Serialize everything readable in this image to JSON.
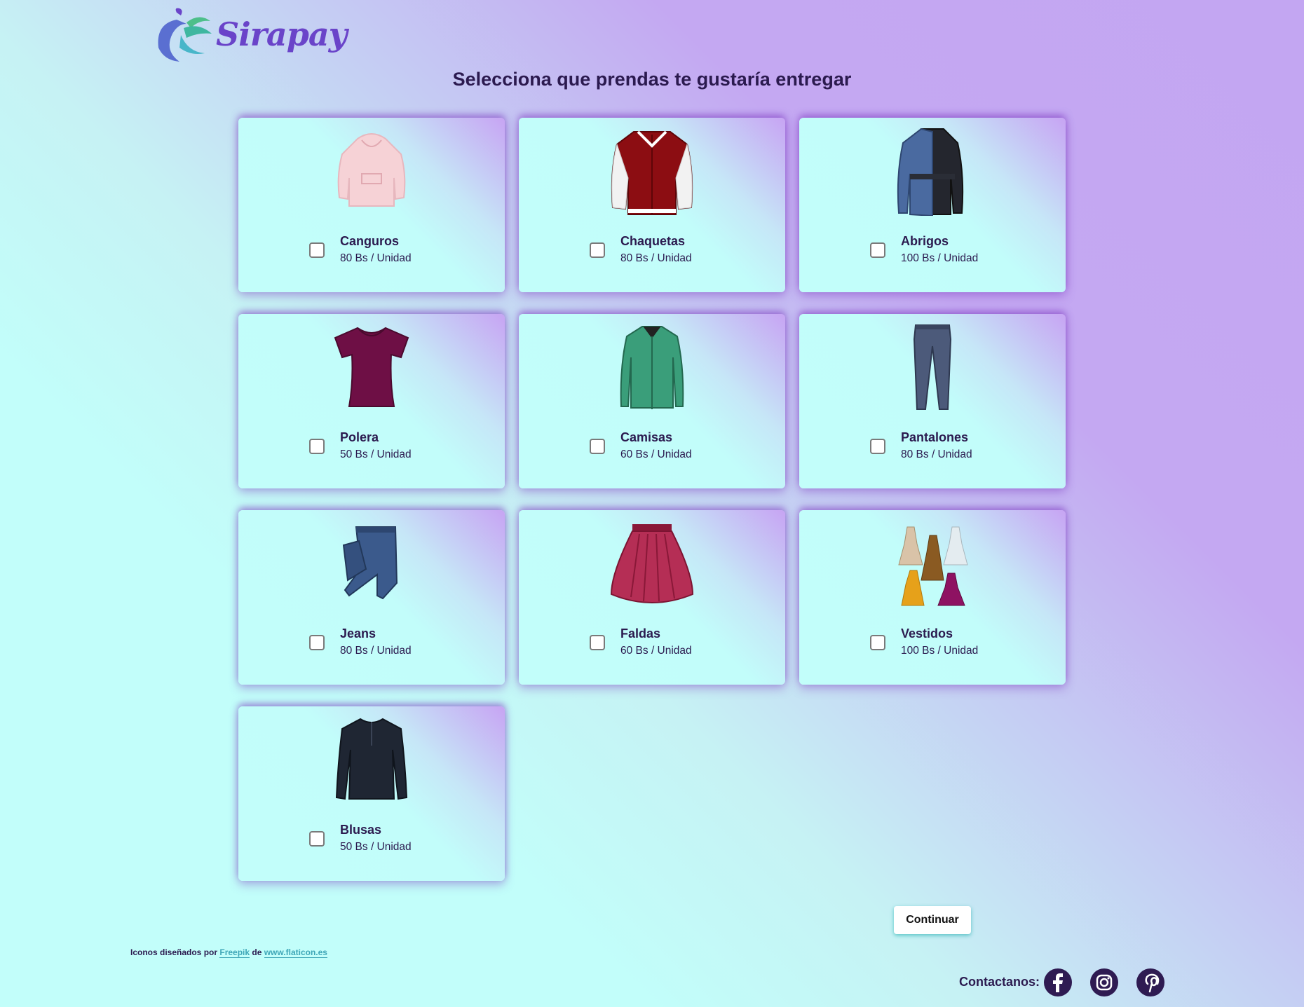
{
  "brand": {
    "name": "Sirapay"
  },
  "page": {
    "title": "Selecciona que prendas te gustaría entregar"
  },
  "items": [
    {
      "name": "Canguros",
      "price": "80 Bs / Unidad",
      "icon": "hoodie-icon"
    },
    {
      "name": "Chaquetas",
      "price": "80 Bs / Unidad",
      "icon": "jacket-icon"
    },
    {
      "name": "Abrigos",
      "price": "100 Bs / Unidad",
      "icon": "coat-icon"
    },
    {
      "name": "Polera",
      "price": "50 Bs / Unidad",
      "icon": "tshirt-icon"
    },
    {
      "name": "Camisas",
      "price": "60 Bs / Unidad",
      "icon": "shirt-icon"
    },
    {
      "name": "Pantalones",
      "price": "80 Bs / Unidad",
      "icon": "pants-icon"
    },
    {
      "name": "Jeans",
      "price": "80 Bs / Unidad",
      "icon": "jeans-icon"
    },
    {
      "name": "Faldas",
      "price": "60 Bs / Unidad",
      "icon": "skirt-icon"
    },
    {
      "name": "Vestidos",
      "price": "100 Bs / Unidad",
      "icon": "dresses-icon"
    },
    {
      "name": "Blusas",
      "price": "50 Bs / Unidad",
      "icon": "blouse-icon"
    }
  ],
  "actions": {
    "continue_label": "Continuar"
  },
  "footer": {
    "credits_prefix": "Iconos diseñados por ",
    "credits_author": "Freepik",
    "credits_mid": " de ",
    "credits_site": "www.flaticon.es",
    "contact_label": "Contactanos:",
    "social": [
      "facebook-icon",
      "instagram-icon",
      "pinterest-icon"
    ]
  },
  "colors": {
    "accent": "#6a44c9",
    "text": "#2b1a4f",
    "link": "#3fa7b8",
    "social_bg": "#2f1b52"
  }
}
